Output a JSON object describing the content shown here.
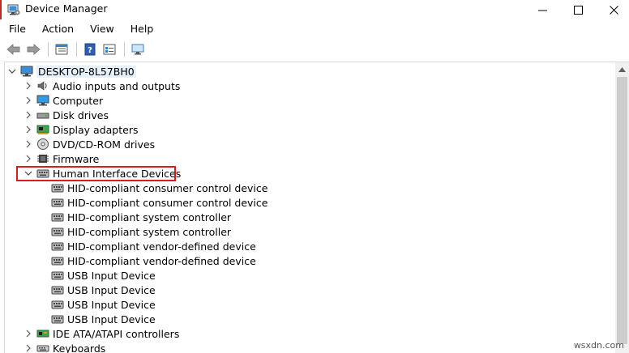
{
  "window": {
    "title": "Device Manager",
    "minimize_label": "—",
    "maximize_label": "☐",
    "close_label": "✕"
  },
  "menu": [
    "File",
    "Action",
    "View",
    "Help"
  ],
  "tree": {
    "root": "DESKTOP-8L57BH0",
    "categories": [
      {
        "label": "Audio inputs and outputs",
        "icon": "speaker-icon"
      },
      {
        "label": "Computer",
        "icon": "monitor-icon"
      },
      {
        "label": "Disk drives",
        "icon": "disk-drive-icon"
      },
      {
        "label": "Display adapters",
        "icon": "display-adapter-icon"
      },
      {
        "label": "DVD/CD-ROM drives",
        "icon": "dvd-drive-icon"
      },
      {
        "label": "Firmware",
        "icon": "firmware-icon"
      },
      {
        "label": "Human Interface Devices",
        "icon": "hid-icon",
        "expanded": true
      },
      {
        "label": "IDE ATA/ATAPI controllers",
        "icon": "ide-controller-icon"
      },
      {
        "label": "Keyboards",
        "icon": "keyboard-icon"
      }
    ],
    "hid_children": [
      "HID-compliant consumer control device",
      "HID-compliant consumer control device",
      "HID-compliant system controller",
      "HID-compliant system controller",
      "HID-compliant vendor-defined device",
      "HID-compliant vendor-defined device",
      "USB Input Device",
      "USB Input Device",
      "USB Input Device",
      "USB Input Device"
    ]
  },
  "watermark": "wsxdn.com"
}
